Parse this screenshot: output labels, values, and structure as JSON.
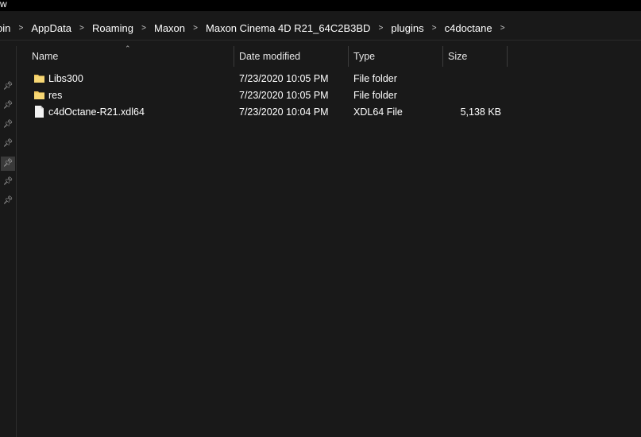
{
  "menu": {
    "partial_label": "w"
  },
  "breadcrumb": {
    "items": [
      "oin",
      "AppData",
      "Roaming",
      "Maxon",
      "Maxon Cinema 4D R21_64C2B3BD",
      "plugins",
      "c4doctane"
    ],
    "separator": ">"
  },
  "columns": {
    "name": "Name",
    "date_modified": "Date modified",
    "type": "Type",
    "size": "Size"
  },
  "files": [
    {
      "name": "Libs300",
      "date": "7/23/2020 10:05 PM",
      "type": "File folder",
      "size": "",
      "icon": "folder-icon"
    },
    {
      "name": "res",
      "date": "7/23/2020 10:05 PM",
      "type": "File folder",
      "size": "",
      "icon": "folder-icon"
    },
    {
      "name": "c4dOctane-R21.xdl64",
      "date": "7/23/2020 10:04 PM",
      "type": "XDL64 File",
      "size": "5,138 KB",
      "icon": "file-icon"
    }
  ],
  "colors": {
    "background": "#191919",
    "folder": "#f0c75e",
    "file": "#f2f2f2"
  }
}
